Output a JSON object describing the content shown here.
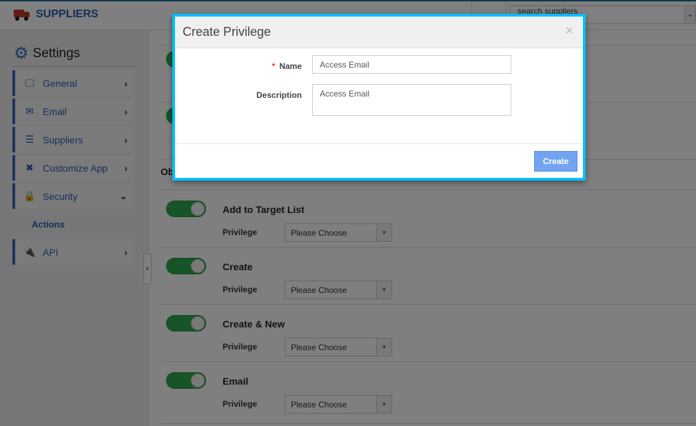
{
  "header": {
    "brand": "SUPPLIERS",
    "search_placeholder": "search suppliers"
  },
  "sidebar": {
    "title": "Settings",
    "items": [
      {
        "label": "General",
        "icon": "monitor-icon"
      },
      {
        "label": "Email",
        "icon": "envelope-icon"
      },
      {
        "label": "Suppliers",
        "icon": "list-icon"
      },
      {
        "label": "Customize App",
        "icon": "tools-icon"
      },
      {
        "label": "Security",
        "icon": "lock-icon"
      },
      {
        "label": "API",
        "icon": "plug-icon"
      }
    ],
    "sub_item": "Actions"
  },
  "content": {
    "section_heading_partial": "Ob",
    "privilege_label": "Privilege",
    "rows": [
      {
        "title": "Add to Target List",
        "privilege": "Please Choose",
        "enabled": true
      },
      {
        "title": "Create",
        "privilege": "Please Choose",
        "enabled": true
      },
      {
        "title": "Create & New",
        "privilege": "Please Choose",
        "enabled": true
      },
      {
        "title": "Email",
        "privilege": "Please Choose",
        "enabled": true
      }
    ]
  },
  "modal": {
    "title": "Create Privilege",
    "close": "×",
    "name_label": "Name",
    "required_mark": "*",
    "name_value": "Access Email",
    "description_label": "Description",
    "description_value": "Access Email",
    "create_button": "Create"
  },
  "colors": {
    "accent": "#2a5db0",
    "modal_border": "#00bfff",
    "toggle_on": "#2fa84f",
    "button": "#74a3f2"
  }
}
